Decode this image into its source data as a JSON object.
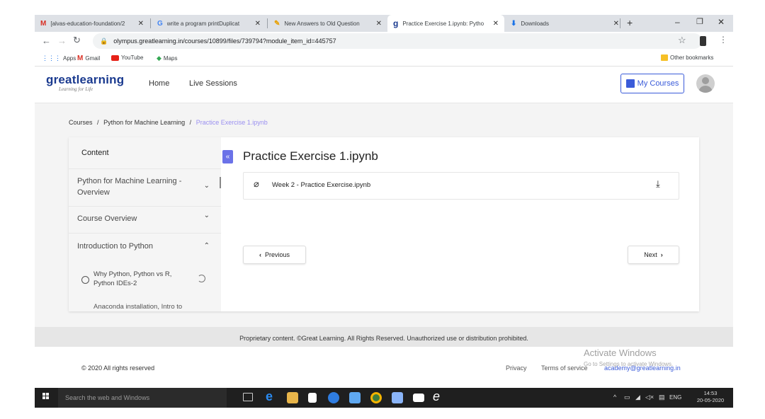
{
  "browser": {
    "tabs": [
      {
        "favicon": "M",
        "title": "[alvas-education-foundation/2"
      },
      {
        "favicon": "G",
        "title": "write a program printDuplicat"
      },
      {
        "favicon": "✎",
        "title": "New Answers to Old Question"
      },
      {
        "favicon": "g",
        "title": "Practice Exercise 1.ipynb: Pytho"
      },
      {
        "favicon": "⬇",
        "title": "Downloads"
      }
    ],
    "new_tab": "+",
    "url": "olympus.greatlearning.in/courses/10899/files/739794?module_item_id=445757",
    "bookmarks": [
      "Apps",
      "Gmail",
      "YouTube",
      "Maps"
    ],
    "other_bookmarks": "Other bookmarks"
  },
  "site": {
    "logo_main": "greatlearning",
    "logo_tag": "Learning for Life",
    "nav": [
      "Home",
      "Live Sessions"
    ],
    "my_courses": "My Courses"
  },
  "breadcrumb": {
    "items": [
      "Courses",
      "Python for Machine Learning",
      "Practice Exercise 1.ipynb"
    ],
    "separator": "/"
  },
  "sidebar": {
    "heading": "Content",
    "items": [
      {
        "label": "Python for Machine Learning - Overview",
        "expanded": false
      },
      {
        "label": "Course Overview",
        "expanded": false
      },
      {
        "label": "Introduction to Python",
        "expanded": true
      }
    ],
    "subitems": [
      {
        "label": "Why Python, Python vs R, Python IDEs-2"
      },
      {
        "label": "Anaconda installation, Intro to"
      }
    ],
    "collapse_label": "«"
  },
  "main": {
    "title": "Practice Exercise 1.ipynb",
    "attachment": "Week 2 - Practice Exercise.ipynb",
    "previous": "Previous",
    "next": "Next"
  },
  "footer": {
    "notice": "Proprietary content. ©Great Learning. All Rights Reserved. Unauthorized use or distribution prohibited.",
    "copyright": "© 2020 All rights reserved",
    "privacy": "Privacy",
    "terms": "Terms of service",
    "email": "academy@greatlearning.in"
  },
  "watermark": {
    "line1": "Activate Windows",
    "line2": "Go to Settings to activate Windows."
  },
  "taskbar": {
    "search_placeholder": "Search the web and Windows",
    "lang": "ENG",
    "time": "14:53",
    "date": "20-05-2020"
  },
  "colors": {
    "brand_blue": "#1a3a8f",
    "accent_purple": "#7b6cf6",
    "link_blue": "#3a5bd9"
  }
}
